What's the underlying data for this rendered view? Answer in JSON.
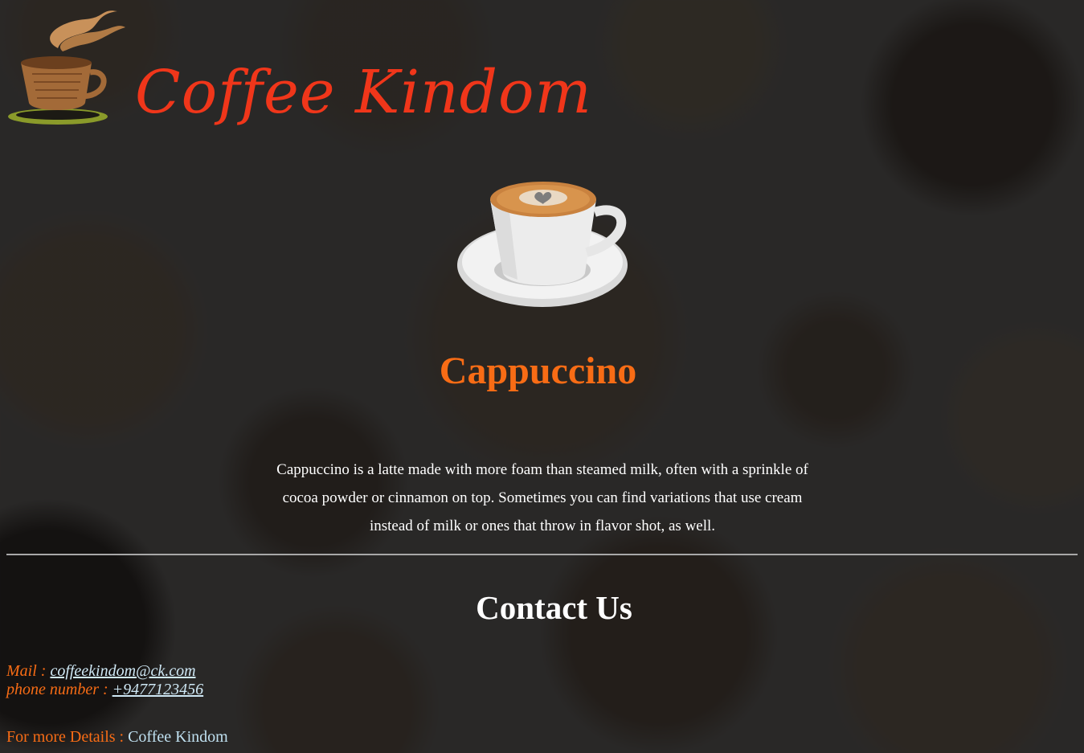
{
  "header": {
    "logo_icon": "coffee-cup-logo",
    "brand_name": "Coffee Kindom",
    "brand_color": "#f0361a"
  },
  "product": {
    "image_icon": "cappuccino-cup-image",
    "title": "Cappuccino",
    "title_color": "#f86c15",
    "description": "Cappuccino is a latte made with more foam than steamed milk, often with a sprinkle of cocoa powder or cinnamon on top. Sometimes you can find variations that use cream instead of milk or ones that throw in flavor shot, as well."
  },
  "contact": {
    "title": "Contact Us",
    "mail_label": "Mail : ",
    "mail_value": "coffeekindom@ck.com ",
    "phone_label": "phone number : ",
    "phone_value": "+9477123456",
    "details_label": "For more Details : ",
    "details_value": "Coffee Kindom",
    "label_color": "#f86c15",
    "link_color": "#cfe8f5"
  }
}
